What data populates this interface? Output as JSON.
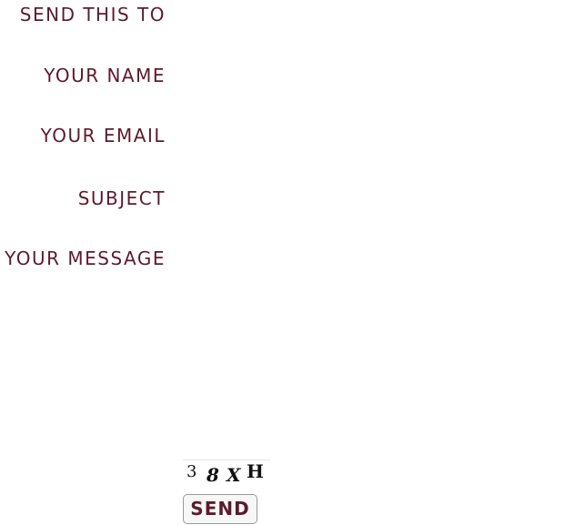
{
  "form": {
    "fields": [
      {
        "label": "SEND THIS TO",
        "value": "",
        "placeholder": ""
      },
      {
        "label": "YOUR NAME",
        "value": "",
        "placeholder": ""
      },
      {
        "label": "YOUR EMAIL",
        "value": "",
        "placeholder": ""
      },
      {
        "label": "SUBJECT",
        "value": "",
        "placeholder": ""
      },
      {
        "label": "YOUR MESSAGE",
        "value": "",
        "placeholder": ""
      }
    ],
    "captcha": {
      "chars": [
        "3",
        "8",
        "X",
        "H"
      ]
    },
    "send_label": "SEND"
  },
  "colors": {
    "label": "#5e1a2e",
    "background": "#ffffff",
    "button_bg": "#f7f7f7",
    "button_border": "#9a9a9a"
  }
}
